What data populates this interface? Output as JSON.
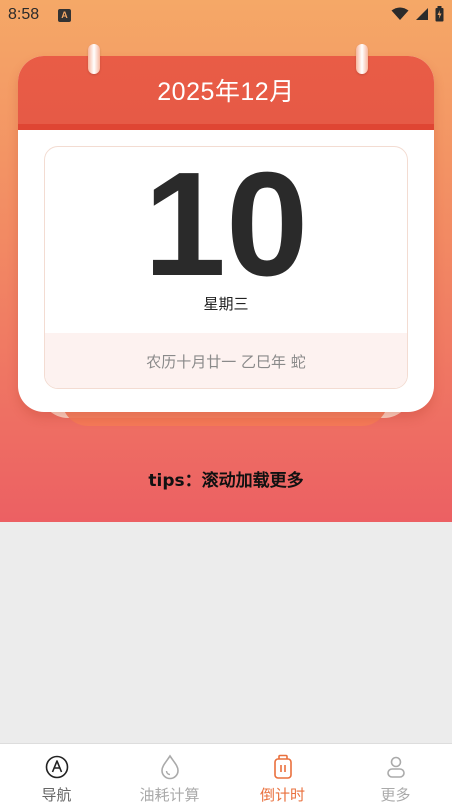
{
  "status_bar": {
    "time": "8:58",
    "app_icon_letter": "A"
  },
  "calendar": {
    "title": "2025年12月",
    "day": "10",
    "weekday": "星期三",
    "lunar": "农历十月廿一 乙巳年 蛇"
  },
  "tips": "tips：滚动加载更多",
  "bottom_nav": {
    "items": [
      {
        "label": "导航",
        "icon": "navigation-icon"
      },
      {
        "label": "油耗计算",
        "icon": "drop-icon"
      },
      {
        "label": "倒计时",
        "icon": "timer-icon",
        "active": true
      },
      {
        "label": "更多",
        "icon": "person-icon"
      }
    ]
  },
  "colors": {
    "accent": "#e9703d",
    "header_red": "#e65a46",
    "gradient_top": "#f5a867",
    "gradient_bottom": "#ec6063"
  }
}
